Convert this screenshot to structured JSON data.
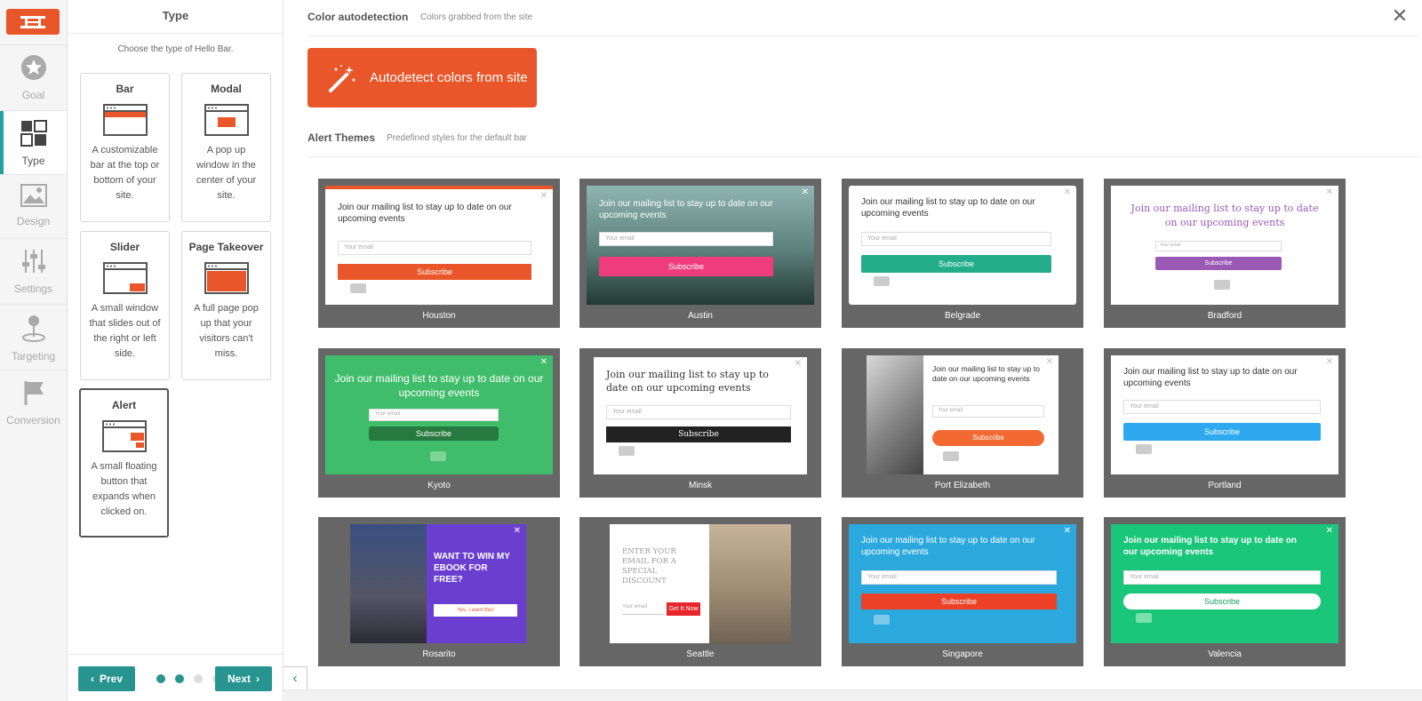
{
  "nav": {
    "items": [
      {
        "label": "Goal",
        "icon": "star-icon"
      },
      {
        "label": "Type",
        "icon": "layout-icon"
      },
      {
        "label": "Design",
        "icon": "image-icon"
      },
      {
        "label": "Settings",
        "icon": "sliders-icon"
      },
      {
        "label": "Targeting",
        "icon": "pin-icon"
      },
      {
        "label": "Conversion",
        "icon": "flag-icon"
      }
    ]
  },
  "panel": {
    "title": "Type",
    "subtitle": "Choose the type of Hello Bar.",
    "types": [
      {
        "name": "Bar",
        "desc": "A customizable bar at the top or bottom of your site."
      },
      {
        "name": "Modal",
        "desc": "A pop up window in the center of your site."
      },
      {
        "name": "Slider",
        "desc": "A small window that slides out of the right or left side."
      },
      {
        "name": "Page Takeover",
        "desc": "A full page pop up that your visitors can't miss."
      },
      {
        "name": "Alert",
        "desc": "A small floating button that expands when clicked on."
      }
    ],
    "prev_label": "Prev",
    "next_label": "Next"
  },
  "main": {
    "color_title": "Color autodetection",
    "color_sub": "Colors grabbed from the site",
    "autodetect_label": "Autodetect colors from site",
    "themes_title": "Alert Themes",
    "themes_sub": "Predefined styles for the default bar",
    "preview_headline": "Join our mailing list to stay up to date on our upcoming events",
    "preview_input": "Your email",
    "preview_button": "Subscribe",
    "themes": [
      {
        "name": "Houston"
      },
      {
        "name": "Austin"
      },
      {
        "name": "Belgrade"
      },
      {
        "name": "Bradford"
      },
      {
        "name": "Kyoto"
      },
      {
        "name": "Minsk"
      },
      {
        "name": "Port Elizabeth"
      },
      {
        "name": "Portland"
      },
      {
        "name": "Rosarito",
        "headline": "WANT TO WIN MY EBOOK FOR FREE?",
        "button": "Yes, I want this!"
      },
      {
        "name": "Seattle",
        "headline": "ENTER YOUR EMAIL FOR A SPECIAL DISCOUNT",
        "input": "Your email",
        "button": "Get It Now"
      },
      {
        "name": "Singapore"
      },
      {
        "name": "Valencia"
      }
    ]
  },
  "colors": {
    "brand": "#e8562a",
    "teal": "#27948f"
  }
}
